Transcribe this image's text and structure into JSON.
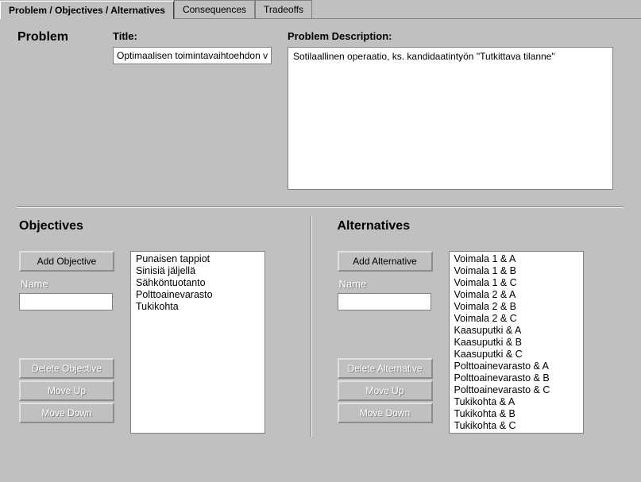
{
  "tabs": {
    "active": "Problem / Objectives / Alternatives",
    "t1": "Consequences",
    "t2": "Tradeoffs"
  },
  "problem": {
    "heading": "Problem",
    "title_label": "Title:",
    "title_value": "Optimaalisen toimintavaihtoehdon v",
    "desc_label": "Problem Description:",
    "desc_value": "Sotilaallinen operaatio, ks. kandidaatintyön \"Tutkittava tilanne\""
  },
  "objectives": {
    "heading": "Objectives",
    "add_label": "Add Objective",
    "name_label": "Name",
    "delete_label": "Delete Objective",
    "up_label": "Move Up",
    "down_label": "Move Down",
    "items": [
      "Punaisen tappiot",
      "Sinisiä jäljellä",
      "Sähköntuotanto",
      "Polttoainevarasto",
      "Tukikohta"
    ]
  },
  "alternatives": {
    "heading": "Alternatives",
    "add_label": "Add Alternative",
    "name_label": "Name",
    "delete_label": "Delete Alternative",
    "up_label": "Move Up",
    "down_label": "Move Down",
    "items": [
      "Voimala 1 & A",
      "Voimala 1 & B",
      "Voimala 1 & C",
      "Voimala 2 & A",
      "Voimala 2 & B",
      "Voimala 2 & C",
      "Kaasuputki & A",
      "Kaasuputki & B",
      "Kaasuputki & C",
      "Polttoainevarasto & A",
      "Polttoainevarasto & B",
      "Polttoainevarasto & C",
      "Tukikohta & A",
      "Tukikohta & B",
      "Tukikohta & C"
    ]
  }
}
